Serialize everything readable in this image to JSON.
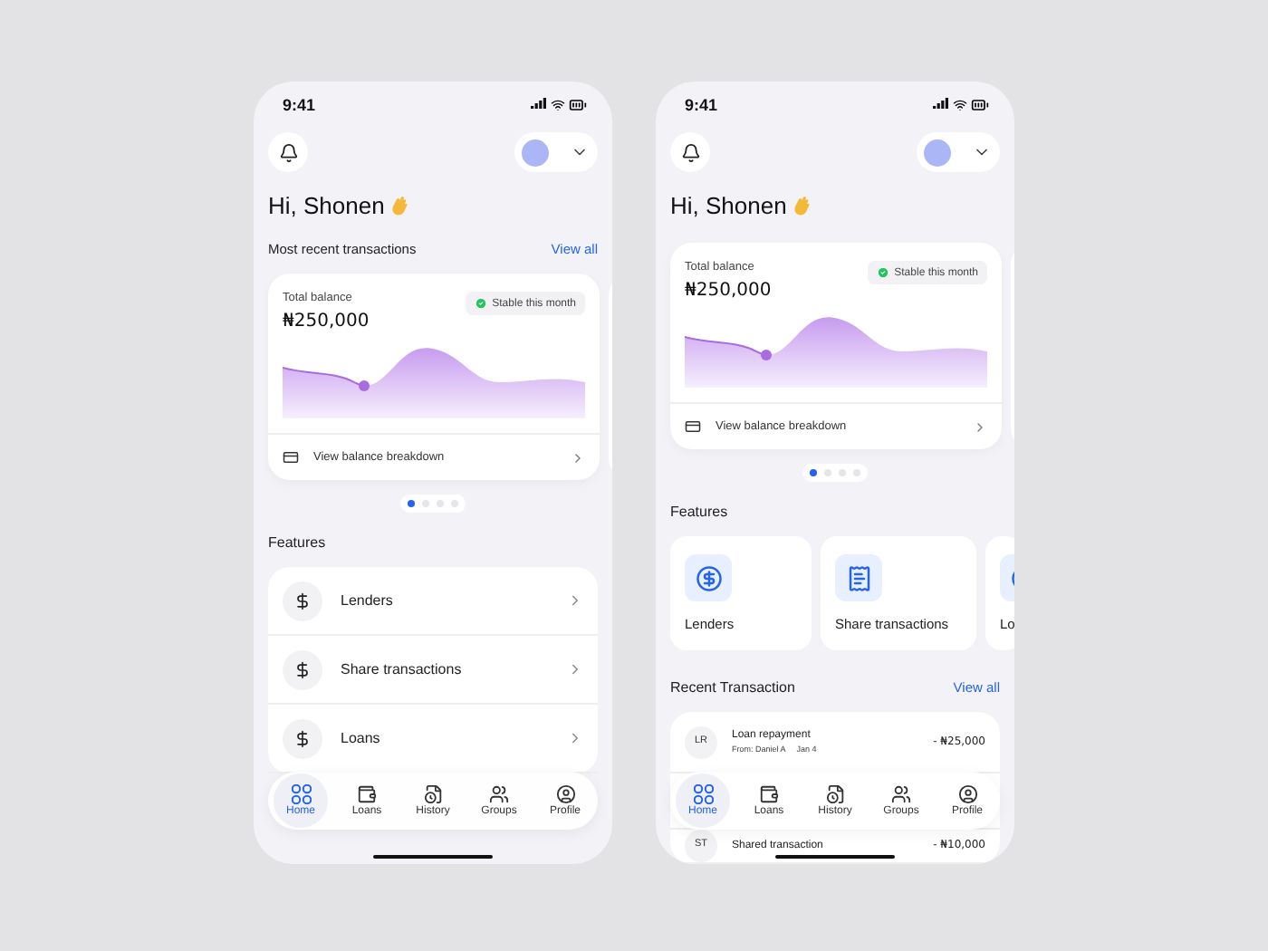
{
  "phones": [
    {
      "status_time": "9:41",
      "greeting": "Hi, Shonen",
      "recent_header": {
        "title": "Most recent transactions",
        "link": "View all"
      },
      "balance": {
        "label": "Total balance",
        "amount": "₦250,000",
        "badge": "Stable this month",
        "footer": "View balance breakdown"
      },
      "dots": [
        {
          "selected": true
        },
        {
          "selected": false
        },
        {
          "selected": false
        },
        {
          "selected": false
        }
      ],
      "features": {
        "title": "Features",
        "kind": "list",
        "items": [
          "Lenders",
          "Share transactions",
          "Loans"
        ]
      },
      "nav": [
        {
          "label": "Home",
          "selected": true
        },
        {
          "label": "Loans",
          "selected": false
        },
        {
          "label": "History",
          "selected": false
        },
        {
          "label": "Groups",
          "selected": false
        },
        {
          "label": "Profile",
          "selected": false
        }
      ]
    },
    {
      "status_time": "9:41",
      "greeting": "Hi, Shonen",
      "balance": {
        "label": "Total balance",
        "amount": "₦250,000",
        "badge": "Stable this month",
        "footer": "View balance breakdown"
      },
      "dots": [
        {
          "selected": true
        },
        {
          "selected": false
        },
        {
          "selected": false
        },
        {
          "selected": false
        }
      ],
      "features": {
        "title": "Features",
        "kind": "tiles",
        "items": [
          "Lenders",
          "Share transactions",
          "Lo"
        ]
      },
      "recent": {
        "title": "Recent Transaction",
        "link": "View all",
        "transactions": [
          {
            "initials": "LR",
            "title": "Loan repayment",
            "from": "From: Daniel A",
            "date": "Jan 4",
            "amount": "- ₦25,000"
          },
          {
            "initials": "ST",
            "title": "Shared transaction",
            "amount": "- ₦10,000"
          }
        ]
      },
      "nav": [
        {
          "label": "Home",
          "selected": true
        },
        {
          "label": "Loans",
          "selected": false
        },
        {
          "label": "History",
          "selected": false
        },
        {
          "label": "Groups",
          "selected": false
        },
        {
          "label": "Profile",
          "selected": false
        }
      ]
    }
  ]
}
